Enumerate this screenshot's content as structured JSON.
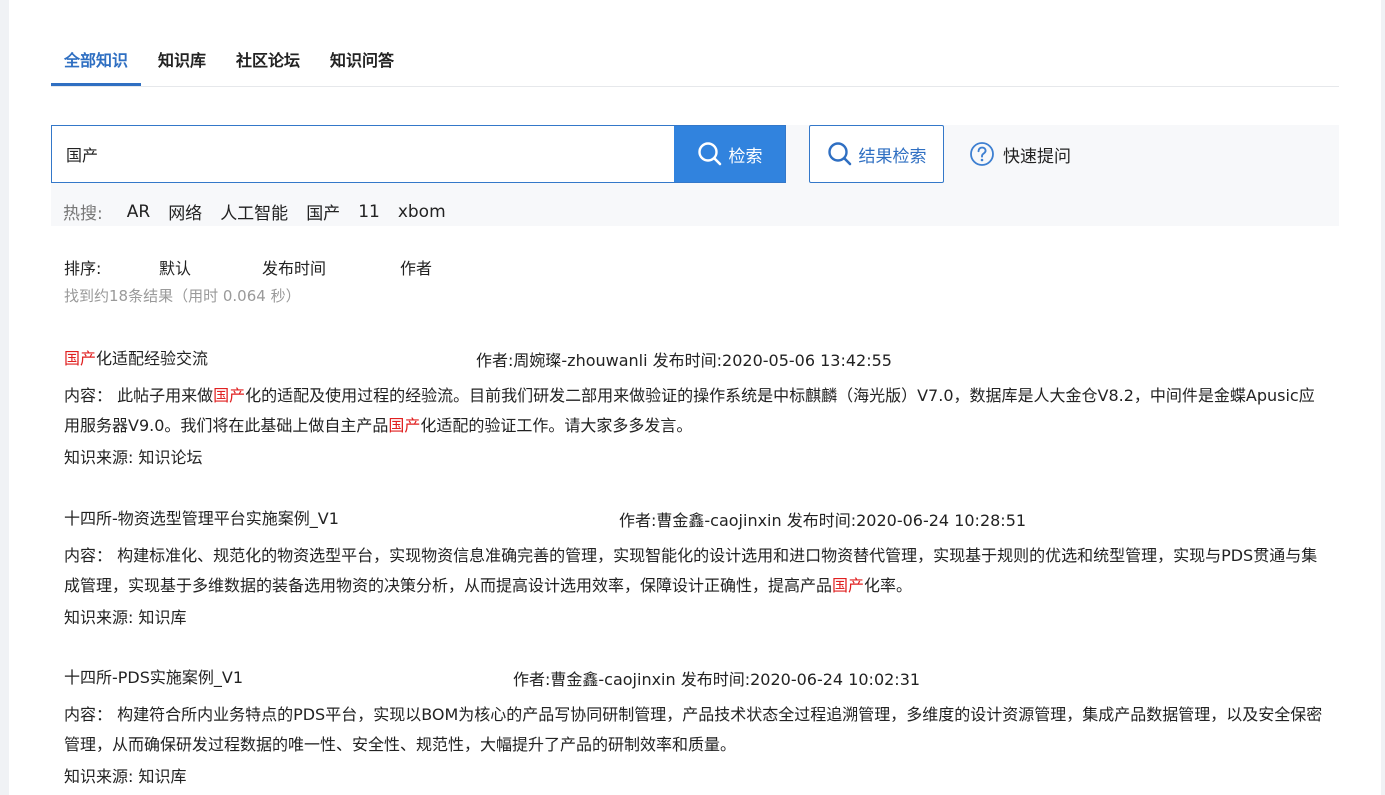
{
  "tabs": [
    "全部知识",
    "知识库",
    "社区论坛",
    "知识问答"
  ],
  "search": {
    "value": "国产",
    "button_label": "检索",
    "result_search_label": "结果检索",
    "quick_ask_label": "快速提问"
  },
  "hot": {
    "label": "热搜:",
    "items": [
      "AR",
      "网络",
      "人工智能",
      "国产",
      "11",
      "xbom"
    ]
  },
  "sort": {
    "label": "排序:",
    "options": [
      "默认",
      "发布时间",
      "作者"
    ]
  },
  "result_count": "找到约18条结果（用时 0.064 秒）",
  "results": [
    {
      "title_hl": "国产",
      "title_rest": "化适配经验交流",
      "meta": "作者:周婉璨-zhouwanli 发布时间:2020-05-06 13:42:55",
      "content": [
        {
          "t": "内容： 此帖子用来做"
        },
        {
          "t": "国产",
          "hl": true
        },
        {
          "t": "化的适配及使用过程的经验流。目前我们研发二部用来做验证的操作系统是中标麒麟（海光版）V7.0，数据库是人大金仓V8.2，中间件是金蝶Apusic应用服务器V9.0。我们将在此基础上做自主产品"
        },
        {
          "t": "国产",
          "hl": true
        },
        {
          "t": "化适配的验证工作。请大家多多发言。"
        }
      ],
      "source": "知识来源:  知识论坛"
    },
    {
      "title_hl": "",
      "title_rest": "十四所-物资选型管理平台实施案例_V1",
      "meta": "作者:曹金鑫-caojinxin 发布时间:2020-06-24 10:28:51",
      "content": [
        {
          "t": "内容： 构建标准化、规范化的物资选型平台，实现物资信息准确完善的管理，实现智能化的设计选用和进口物资替代管理，实现基于规则的优选和统型管理，实现与PDS贯通与集成管理，实现基于多维数据的装备选用物资的决策分析，从而提高设计选用效率，保障设计正确性，提高产品"
        },
        {
          "t": "国产",
          "hl": true
        },
        {
          "t": "化率。"
        }
      ],
      "source": "知识来源:  知识库"
    },
    {
      "title_hl": "",
      "title_rest": "十四所-PDS实施案例_V1",
      "meta": "作者:曹金鑫-caojinxin 发布时间:2020-06-24 10:02:31",
      "content": [
        {
          "t": "内容： 构建符合所内业务特点的PDS平台，实现以BOM为核心的产品写协同研制管理，产品技术状态全过程追溯管理，多维度的设计资源管理，集成产品数据管理，以及安全保密管理，从而确保研发过程数据的唯一性、安全性、规范性，大幅提升了产品的研制效率和质量。"
        }
      ],
      "source": "知识来源:  知识库"
    }
  ],
  "colors": {
    "accent": "#3183de",
    "highlight": "#e02020",
    "active_tab": "#2f6fc2"
  }
}
